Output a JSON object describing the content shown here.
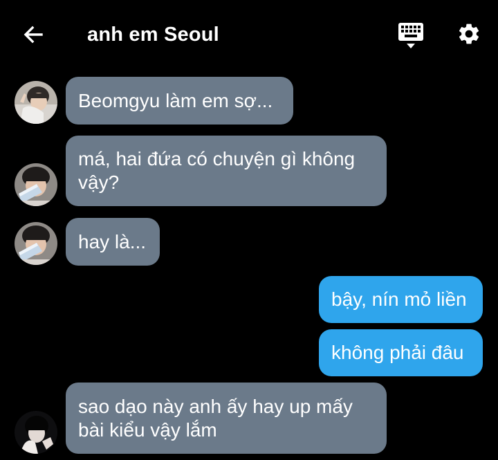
{
  "header": {
    "title": "anh em Seoul",
    "back_icon": "arrow-left-icon",
    "keyboard_icon": "keyboard-icon",
    "settings_icon": "gear-icon"
  },
  "messages": [
    {
      "side": "incoming",
      "sender_avatar": "avatar-1",
      "text": "Beomgyu làm em sợ..."
    },
    {
      "side": "incoming",
      "sender_avatar": "avatar-2",
      "text": "má, hai đứa có chuyện gì không\nvậy?"
    },
    {
      "side": "incoming",
      "sender_avatar": "avatar-2",
      "text": "hay là..."
    },
    {
      "side": "outgoing",
      "text": "bậy, nín mỏ liền"
    },
    {
      "side": "outgoing",
      "text": "không phải đâu"
    },
    {
      "side": "incoming",
      "sender_avatar": "avatar-3",
      "text": "sao dạo này anh ấy hay up mấy\nbài kiểu vậy lắm"
    }
  ],
  "colors": {
    "background": "#000000",
    "incoming_bubble": "#6b7a8a",
    "outgoing_bubble": "#2fa5ec",
    "text": "#ffffff"
  }
}
